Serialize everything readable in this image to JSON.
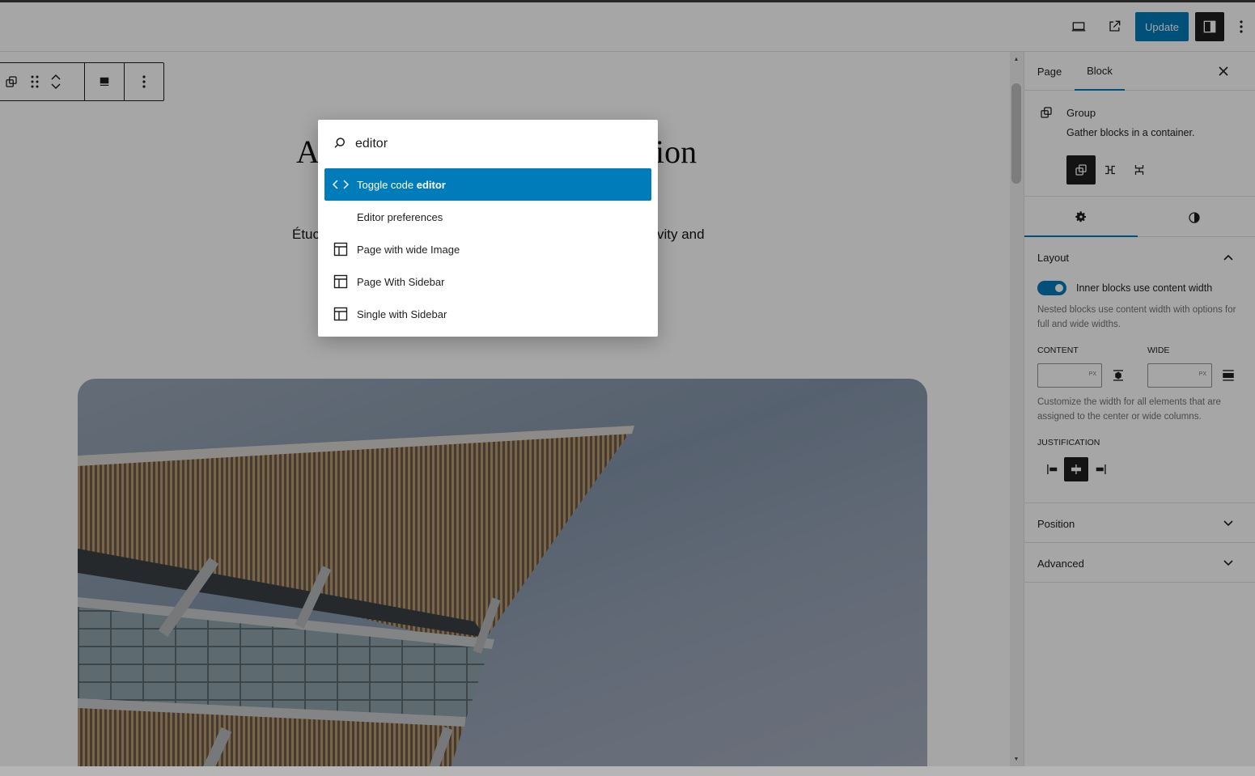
{
  "header": {
    "update_label": "Update"
  },
  "canvas": {
    "title_left": "A",
    "title_right": "ion",
    "intro_left": "Étuc",
    "intro_right": "vity and"
  },
  "sidebar": {
    "tabs": [
      {
        "label": "Page",
        "active": false
      },
      {
        "label": "Block",
        "active": true
      }
    ],
    "block": {
      "name": "Group",
      "description": "Gather blocks in a container."
    },
    "layout": {
      "title": "Layout",
      "toggle_label": "Inner blocks use content width",
      "toggle_on": true,
      "toggle_help": "Nested blocks use content width with options for full and wide widths.",
      "content_label": "CONTENT",
      "wide_label": "WIDE",
      "unit": "PX",
      "width_help": "Customize the width for all elements that are assigned to the center or wide columns.",
      "justification_label": "JUSTIFICATION"
    },
    "position_title": "Position",
    "advanced_title": "Advanced"
  },
  "palette": {
    "query": "editor",
    "items": [
      {
        "label_prefix": "Toggle code ",
        "label_match": "editor",
        "label_suffix": "",
        "icon": "code-icon",
        "selected": true
      },
      {
        "label_prefix": "",
        "label_match": "Editor",
        "label_suffix": " preferences",
        "icon": "",
        "selected": false
      },
      {
        "label_prefix": "Page with wide Image",
        "label_match": "",
        "label_suffix": "",
        "icon": "layout-icon",
        "selected": false
      },
      {
        "label_prefix": "Page With Sidebar",
        "label_match": "",
        "label_suffix": "",
        "icon": "layout-icon",
        "selected": false
      },
      {
        "label_prefix": "Single with Sidebar",
        "label_match": "",
        "label_suffix": "",
        "icon": "layout-icon",
        "selected": false
      }
    ]
  },
  "colors": {
    "accent": "#007cba",
    "dark": "#1e1e1e",
    "overlay": "rgba(0,0,0,0.35)"
  }
}
